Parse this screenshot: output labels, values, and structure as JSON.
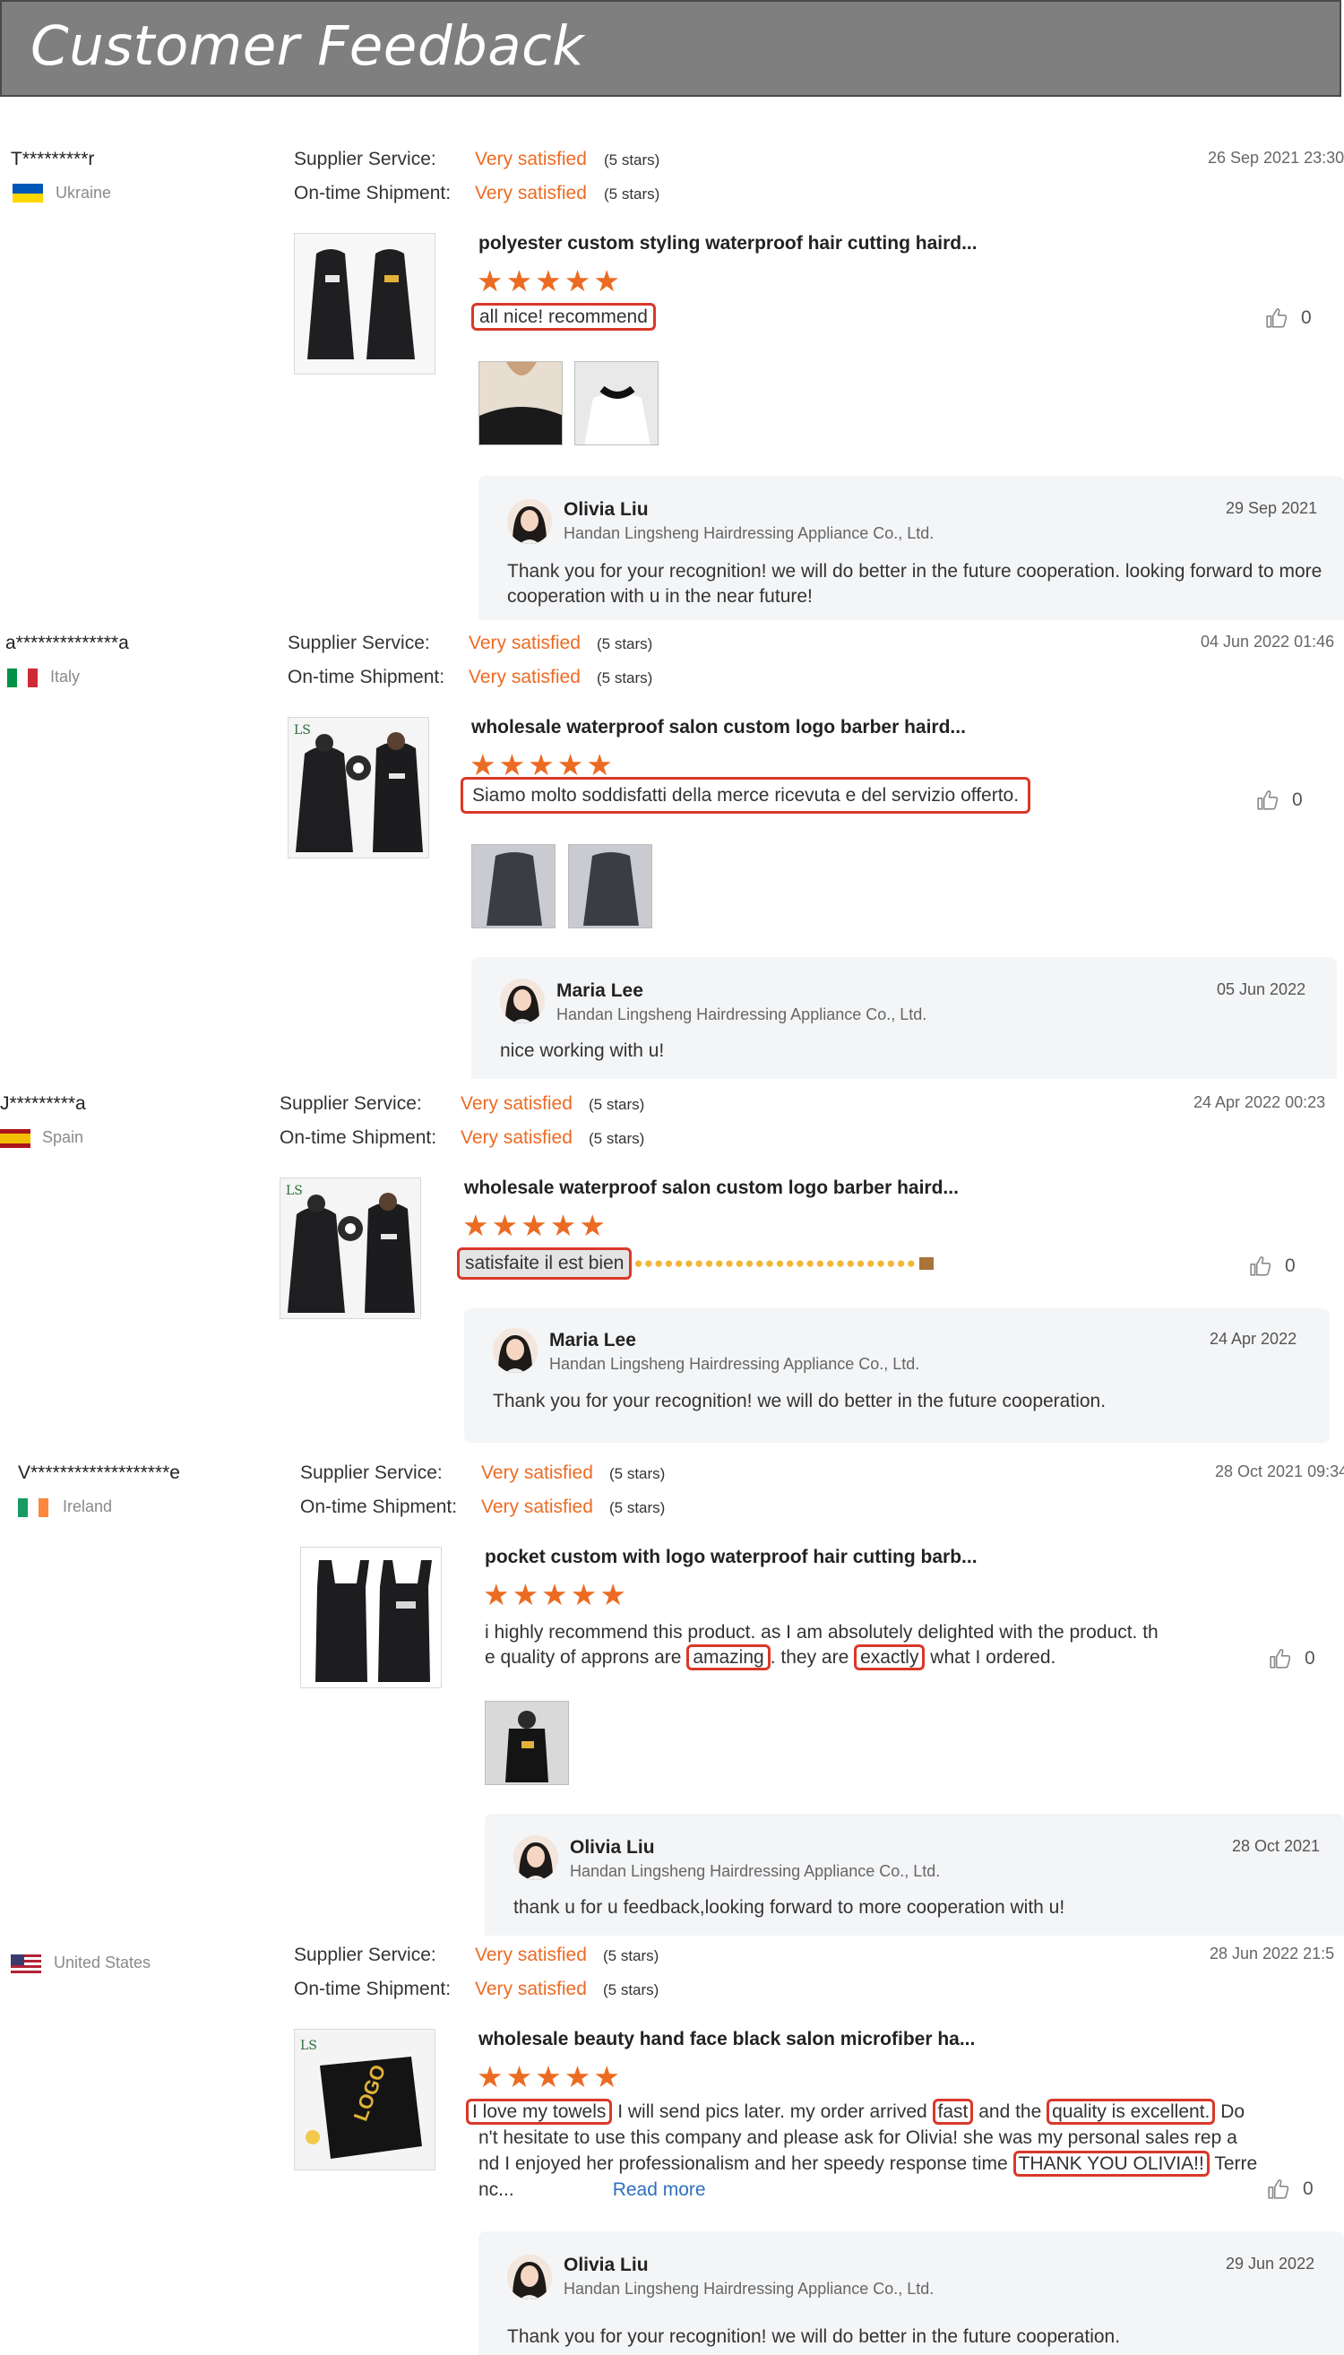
{
  "page": {
    "title": "Customer Feedback"
  },
  "labels": {
    "supplier_service": "Supplier Service:",
    "ontime_shipment": "On-time Shipment:"
  },
  "reviews": [
    {
      "user": "T*********r",
      "country": "Ukraine",
      "flag": "flag-ukraine",
      "date": "26 Sep 2021 23:30",
      "supplier_rating": "Very satisfied",
      "supplier_stars": "(5 stars)",
      "shipment_rating": "Very satisfied",
      "shipment_stars": "(5 stars)",
      "product": "polyester custom styling waterproof hair cutting haird...",
      "stars": 5,
      "text": "all nice! recommend",
      "likes": "0",
      "reply": {
        "name": "Olivia Liu",
        "company": "Handan Lingsheng Hairdressing Appliance Co., Ltd.",
        "date": "29 Sep 2021",
        "message": "Thank you for your recognition! we will do better in the future cooperation. looking forward to more cooperation with u in the near future!"
      }
    },
    {
      "user": "a**************a",
      "country": "Italy",
      "flag": "flag-italy",
      "date": "04 Jun 2022 01:46",
      "supplier_rating": "Very satisfied",
      "supplier_stars": "(5 stars)",
      "shipment_rating": "Very satisfied",
      "shipment_stars": "(5 stars)",
      "product": "wholesale waterproof salon custom logo barber haird...",
      "stars": 5,
      "text": "Siamo molto soddisfatti della merce ricevuta e del servizio offerto.",
      "likes": "0",
      "reply": {
        "name": "Maria Lee",
        "company": "Handan Lingsheng Hairdressing Appliance Co., Ltd.",
        "date": "05 Jun 2022",
        "message": "nice working with u!"
      }
    },
    {
      "user": "J*********a",
      "country": "Spain",
      "flag": "flag-spain",
      "date": "24 Apr 2022 00:23",
      "supplier_rating": "Very satisfied",
      "supplier_stars": "(5 stars)",
      "shipment_rating": "Very satisfied",
      "shipment_stars": "(5 stars)",
      "product": "wholesale waterproof salon custom logo barber haird...",
      "stars": 5,
      "text": "satisfaite il est bien",
      "emoji_count": 28,
      "likes": "0",
      "reply": {
        "name": "Maria Lee",
        "company": "Handan Lingsheng Hairdressing Appliance Co., Ltd.",
        "date": "24 Apr 2022",
        "message": "Thank you for your recognition! we will do better in the future cooperation."
      }
    },
    {
      "user": "V*******************e",
      "country": "Ireland",
      "flag": "flag-ireland",
      "date": "28 Oct 2021 09:34",
      "supplier_rating": "Very satisfied",
      "supplier_stars": "(5 stars)",
      "shipment_rating": "Very satisfied",
      "shipment_stars": "(5 stars)",
      "product": "pocket custom with logo waterproof hair cutting barb...",
      "stars": 5,
      "text_parts": [
        "i highly recommend this product. as I am absolutely delighted with the product. th",
        "e quality of approns are ",
        "amazing",
        ". they are ",
        "exactly",
        " what I ordered."
      ],
      "likes": "0",
      "reply": {
        "name": "Olivia Liu",
        "company": "Handan Lingsheng Hairdressing Appliance Co., Ltd.",
        "date": "28 Oct 2021",
        "message": "thank u for u feedback,looking forward to more cooperation with u!"
      }
    },
    {
      "user": "",
      "country": "United States",
      "flag": "flag-united-states",
      "date": "28 Jun 2022 21:5",
      "supplier_rating": "Very satisfied",
      "supplier_stars": "(5 stars)",
      "shipment_rating": "Very satisfied",
      "shipment_stars": "(5 stars)",
      "product": "wholesale beauty hand face black salon microfiber ha...",
      "stars": 5,
      "text_parts": [
        "I love my towels",
        " I will send pics later. my order arrived ",
        "fast",
        " and the ",
        "quality is excellent.",
        " Do",
        "n't hesitate to use this company and please ask for Olivia! she was my personal sales rep a",
        "nd I enjoyed her professionalism and her speedy response time ",
        "THANK YOU OLIVIA!!",
        " Terre",
        "nc..."
      ],
      "read_more": "Read more",
      "likes": "0",
      "reply": {
        "name": "Olivia Liu",
        "company": "Handan Lingsheng Hairdressing Appliance Co., Ltd.",
        "date": "29 Jun 2022",
        "message": "Thank you for your recognition! we will do better in the future cooperation."
      }
    }
  ],
  "colors": {
    "accent": "#ec6b23",
    "highlight_border": "#d9382a",
    "banner": "#7f7f7f",
    "reply_bg": "#f4f5f7",
    "link": "#2f6fbf"
  }
}
